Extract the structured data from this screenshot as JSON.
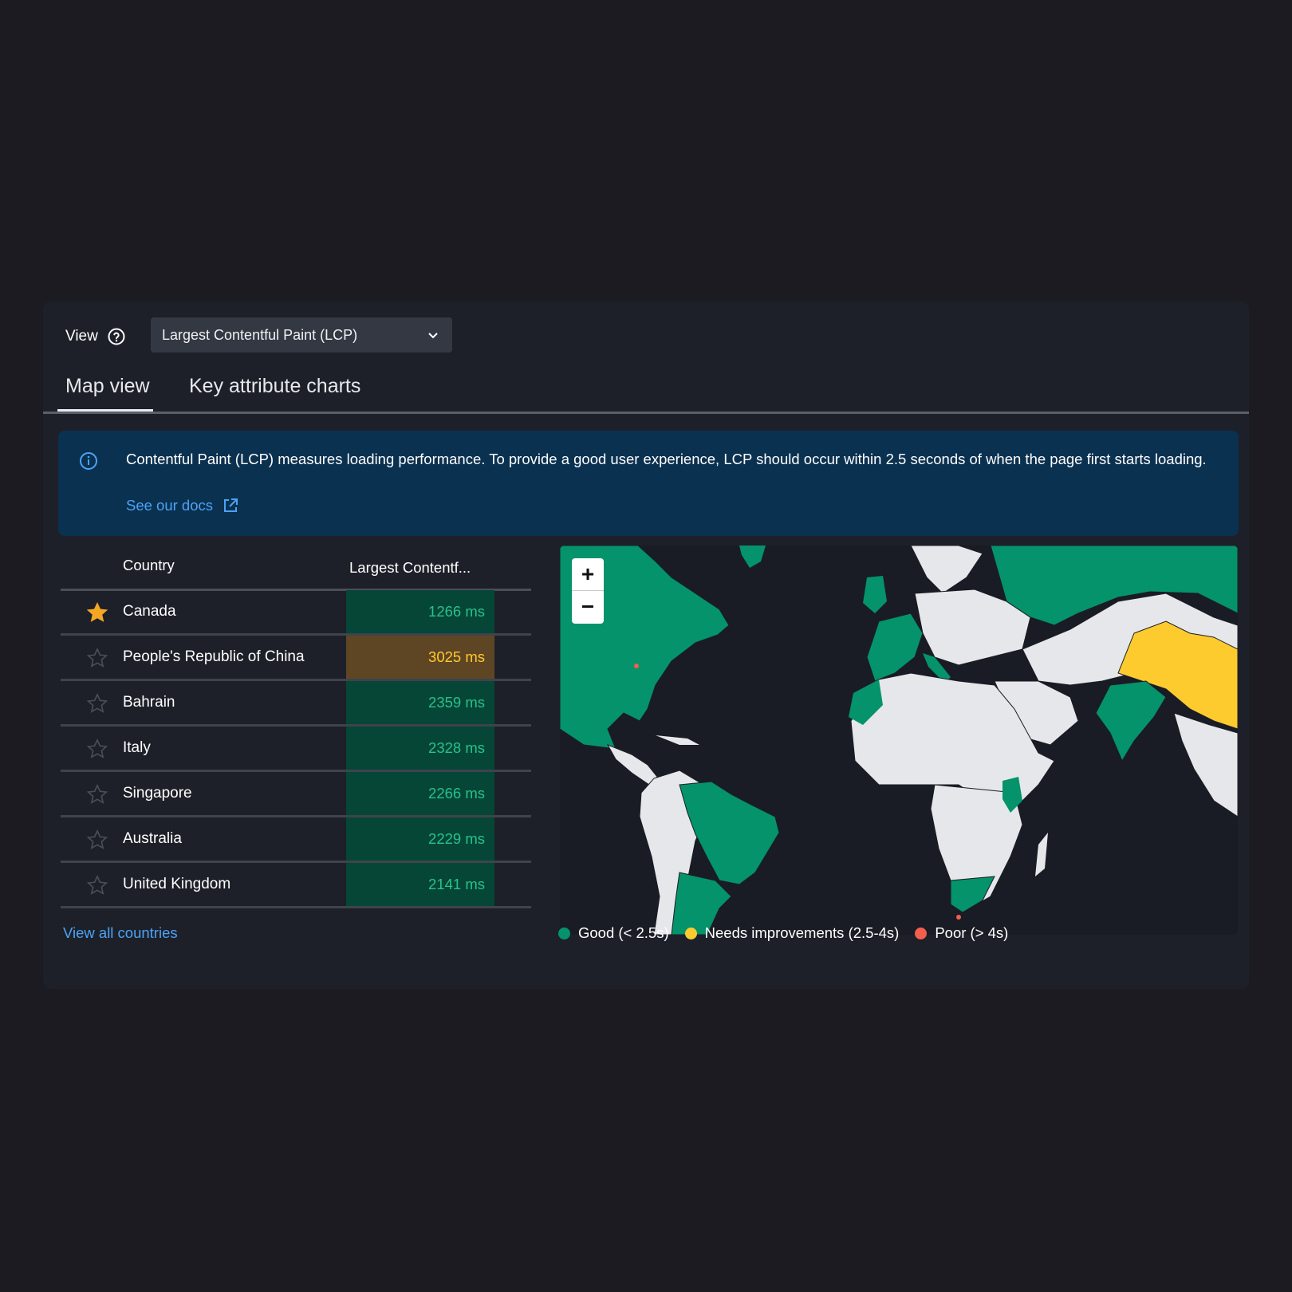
{
  "header": {
    "view_label": "View",
    "select_value": "Largest Contentful Paint (LCP)"
  },
  "tabs": [
    {
      "label": "Map view",
      "active": true
    },
    {
      "label": "Key attribute charts",
      "active": false
    }
  ],
  "info": {
    "text": "Contentful Paint (LCP) measures loading performance. To provide a good user experience, LCP should occur within 2.5 seconds of when the page first starts loading.",
    "link": "See our docs"
  },
  "table": {
    "headers": {
      "country": "Country",
      "metric": "Largest Contentf..."
    },
    "rows": [
      {
        "country": "Canada",
        "value": "1266 ms",
        "status": "good",
        "starred": true
      },
      {
        "country": "People's Republic of China",
        "value": "3025 ms",
        "status": "warn",
        "starred": false
      },
      {
        "country": "Bahrain",
        "value": "2359 ms",
        "status": "good",
        "starred": false
      },
      {
        "country": "Italy",
        "value": "2328 ms",
        "status": "good",
        "starred": false
      },
      {
        "country": "Singapore",
        "value": "2266 ms",
        "status": "good",
        "starred": false
      },
      {
        "country": "Australia",
        "value": "2229 ms",
        "status": "good",
        "starred": false
      },
      {
        "country": "United Kingdom",
        "value": "2141 ms",
        "status": "good",
        "starred": false
      }
    ],
    "view_all": "View all countries"
  },
  "map": {
    "zoom_in": "+",
    "zoom_out": "−"
  },
  "legend": [
    {
      "label": "Good (< 2.5s)",
      "color": "#04936a"
    },
    {
      "label": "Needs improvements (2.5-4s)",
      "color": "#fecb2f"
    },
    {
      "label": "Poor (> 4s)",
      "color": "#f25f4c"
    }
  ],
  "colors": {
    "good": "#04936a",
    "warn": "#fecb2f",
    "neutral": "#e6e7eb",
    "link": "#4ba3f5"
  }
}
